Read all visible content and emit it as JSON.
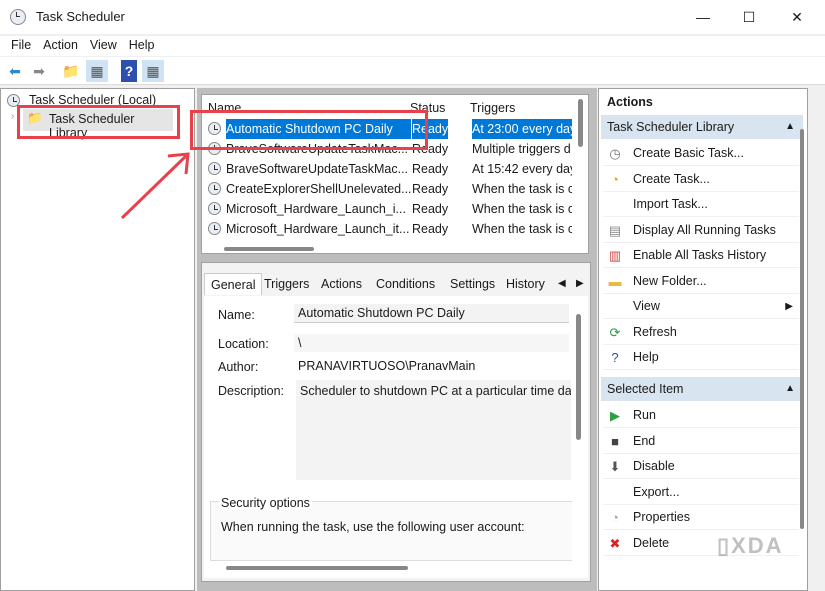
{
  "window": {
    "title": "Task Scheduler",
    "minimize": "—",
    "maximize": "☐",
    "close": "✕"
  },
  "menu": [
    "File",
    "Action",
    "View",
    "Help"
  ],
  "toolbar": {
    "icons": [
      "back-arrow-icon",
      "forward-arrow-icon",
      "folder-up-icon",
      "console-tree-icon",
      "help-icon",
      "action-pane-icon"
    ]
  },
  "tree": {
    "root": "Task Scheduler (Local)",
    "child": "Task Scheduler Library"
  },
  "task_list": {
    "columns": [
      "Name",
      "Status",
      "Triggers"
    ],
    "rows": [
      {
        "name": "Automatic Shutdown PC Daily",
        "status": "Ready",
        "trigger": "At 23:00 every day",
        "selected": true
      },
      {
        "name": "BraveSoftwareUpdateTaskMac...",
        "status": "Ready",
        "trigger": "Multiple triggers d"
      },
      {
        "name": "BraveSoftwareUpdateTaskMac...",
        "status": "Ready",
        "trigger": "At 15:42 every day"
      },
      {
        "name": "CreateExplorerShellUnelevated...",
        "status": "Ready",
        "trigger": "When the task is cr"
      },
      {
        "name": "Microsoft_Hardware_Launch_i...",
        "status": "Ready",
        "trigger": "When the task is cr"
      },
      {
        "name": "Microsoft_Hardware_Launch_it...",
        "status": "Ready",
        "trigger": "When the task is cr"
      }
    ]
  },
  "details": {
    "tabs": [
      "General",
      "Triggers",
      "Actions",
      "Conditions",
      "Settings",
      "History ("
    ],
    "active_tab": "General",
    "name_label": "Name:",
    "name": "Automatic Shutdown PC Daily",
    "location_label": "Location:",
    "location": "\\",
    "author_label": "Author:",
    "author": "PRANAVIRTUOSO\\PranavMain",
    "description_label": "Description:",
    "description": "Scheduler to shutdown PC at a particular time dail",
    "security_title": "Security options",
    "security_text": "When running the task, use the following user account:"
  },
  "actions": {
    "title": "Actions",
    "section1": "Task Scheduler Library",
    "items1": [
      {
        "label": "Create Basic Task...",
        "icon": "create-basic-task-icon"
      },
      {
        "label": "Create Task...",
        "icon": "create-task-icon"
      },
      {
        "label": "Import Task...",
        "icon": ""
      },
      {
        "label": "Display All Running Tasks",
        "icon": "running-tasks-icon"
      },
      {
        "label": "Enable All Tasks History",
        "icon": "history-icon"
      },
      {
        "label": "New Folder...",
        "icon": "folder-icon"
      },
      {
        "label": "View",
        "icon": ""
      },
      {
        "label": "Refresh",
        "icon": "refresh-icon"
      },
      {
        "label": "Help",
        "icon": "help-icon"
      }
    ],
    "section2": "Selected Item",
    "items2": [
      {
        "label": "Run",
        "icon": "run-icon"
      },
      {
        "label": "End",
        "icon": "end-icon"
      },
      {
        "label": "Disable",
        "icon": "disable-icon"
      },
      {
        "label": "Export...",
        "icon": ""
      },
      {
        "label": "Properties",
        "icon": "properties-icon"
      },
      {
        "label": "Delete",
        "icon": "delete-icon"
      }
    ]
  },
  "watermark": "XDA",
  "colors": {
    "selection": "#0078d7",
    "annotation": "#e8414a",
    "section_header": "#d8e4f0"
  }
}
